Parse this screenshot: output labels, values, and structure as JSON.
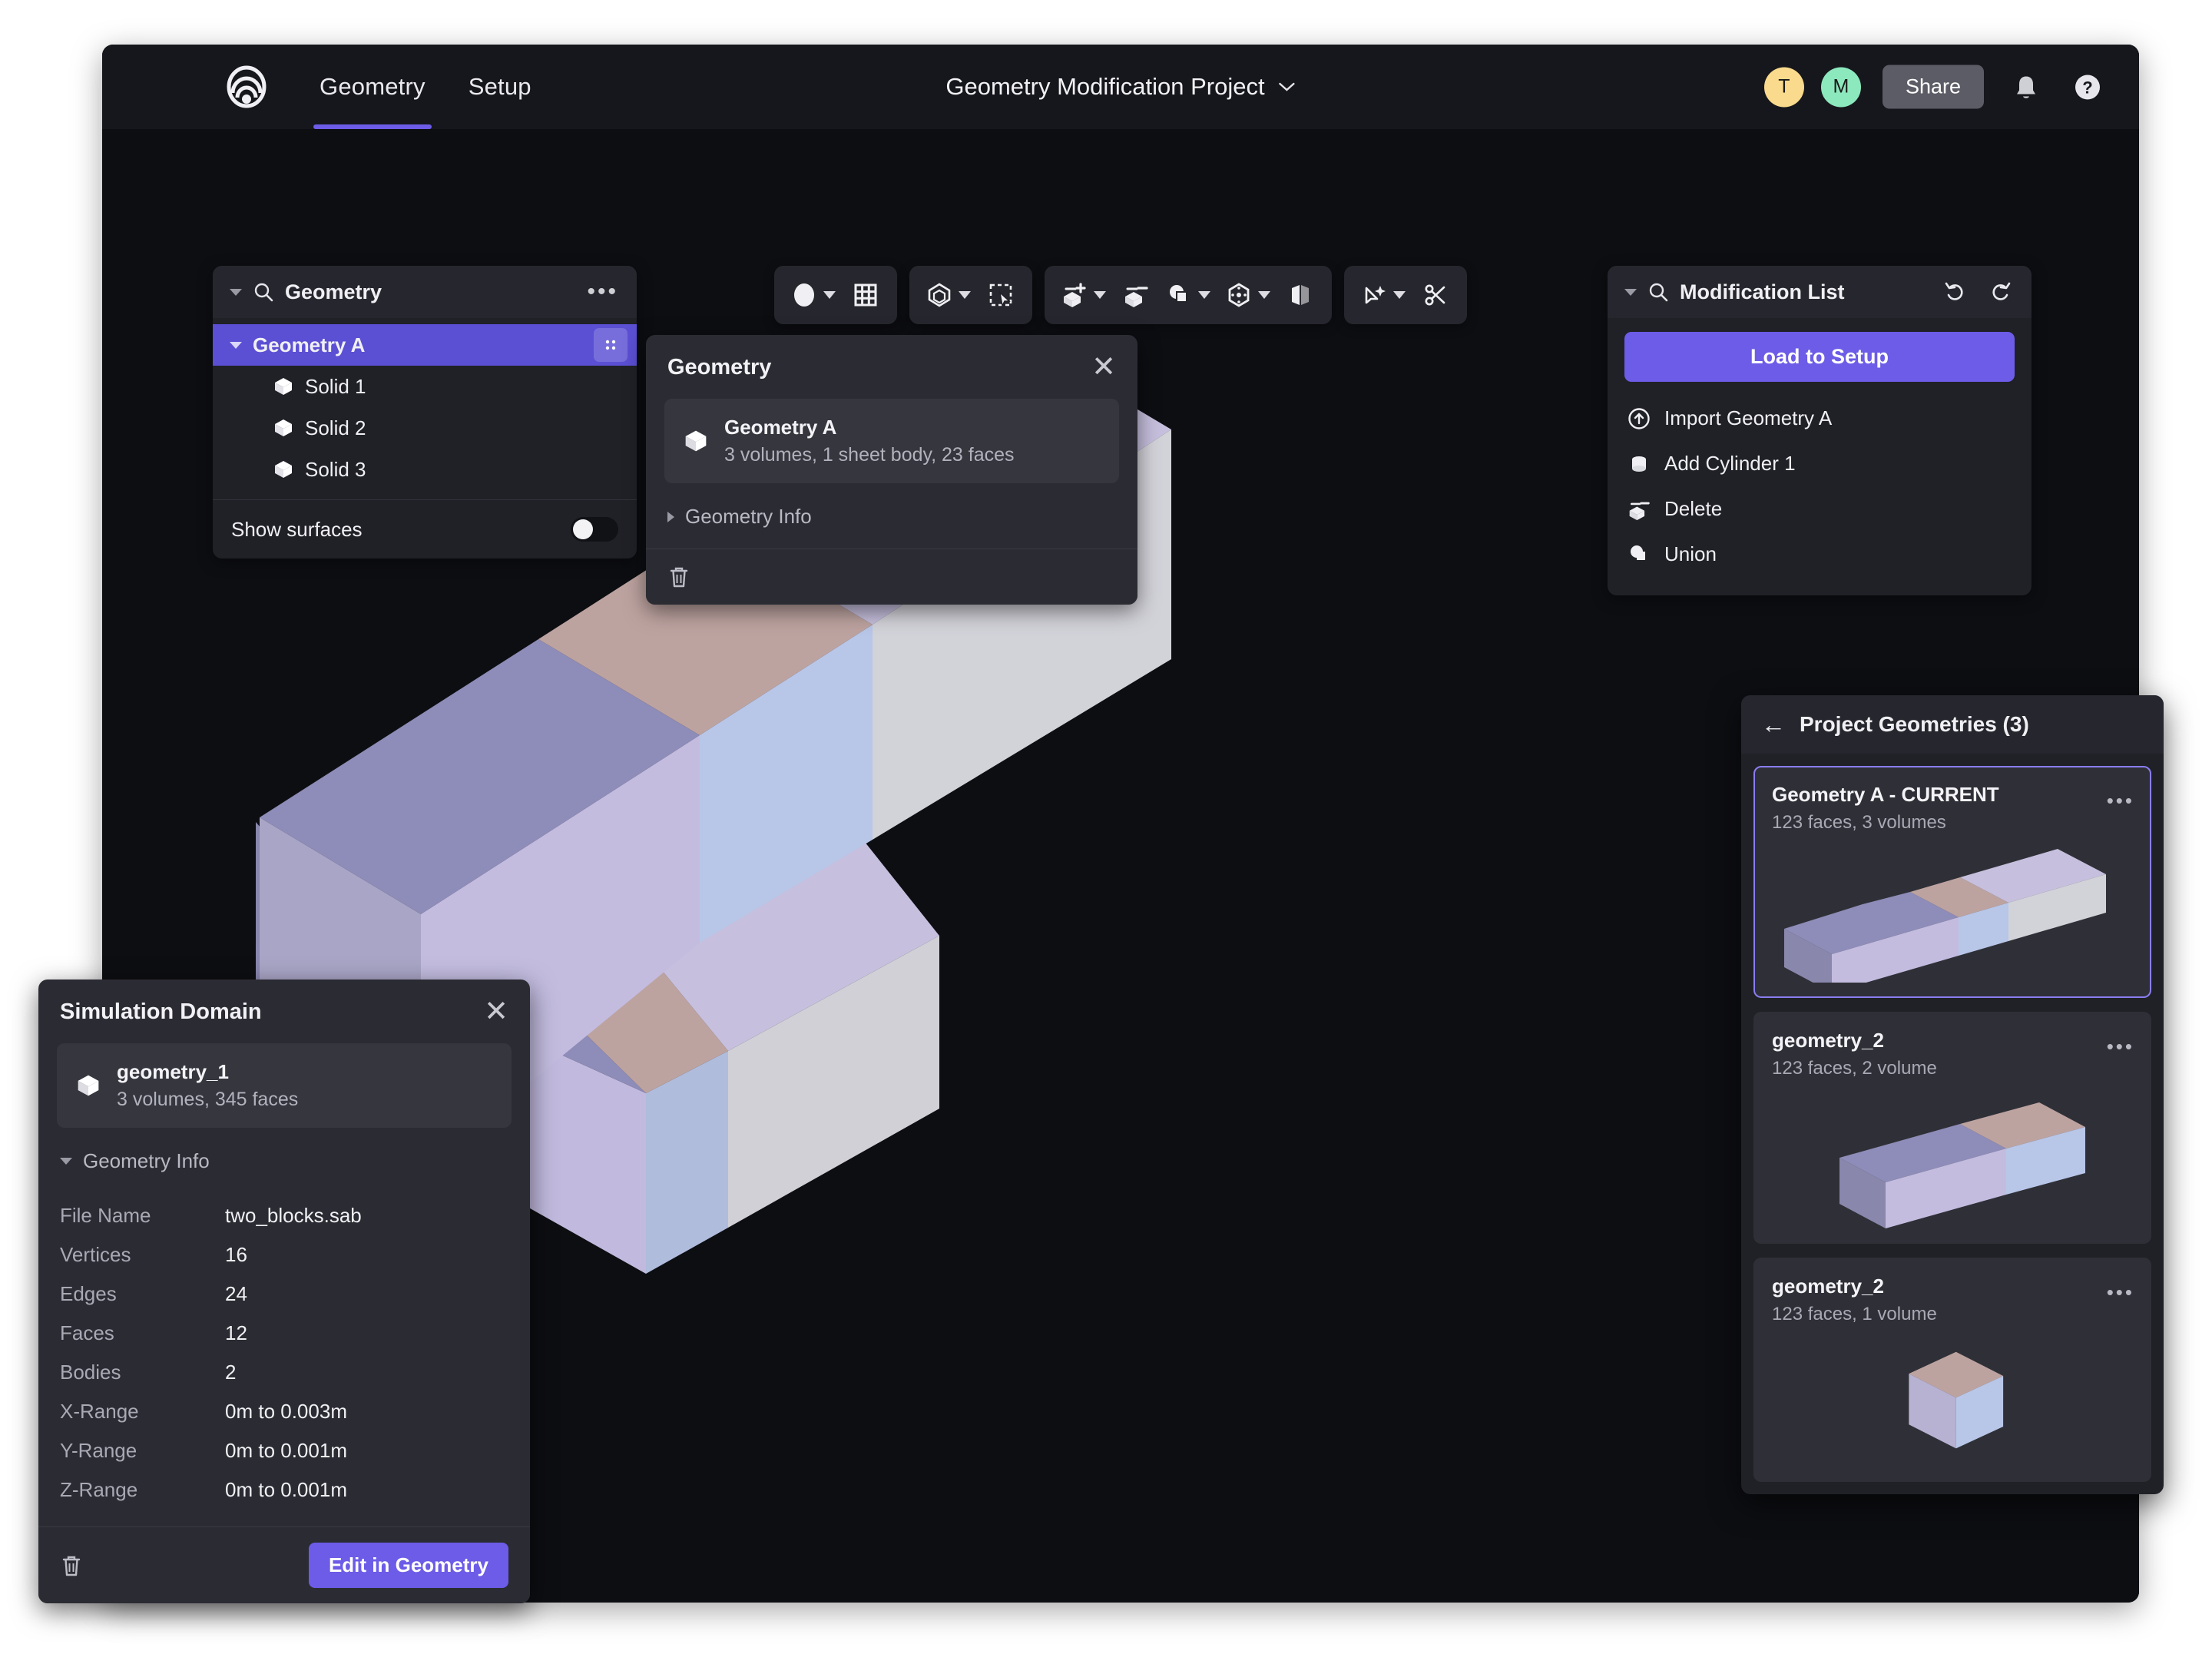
{
  "app": {
    "logo_icon": "concentric-waves-logo",
    "nav_tabs": [
      {
        "label": "Geometry",
        "active": true
      },
      {
        "label": "Setup",
        "active": false
      }
    ],
    "project_title": "Geometry Modification Project",
    "title_chevron_icon": "chevron-down-icon",
    "avatars": [
      {
        "initial": "T",
        "color": "#fada8c"
      },
      {
        "initial": "M",
        "color": "#8ce8bd"
      }
    ],
    "share_label": "Share",
    "notification_icon": "bell-icon",
    "help_icon": "question-mark-circle-icon"
  },
  "tree_panel": {
    "collapse_icon": "caret-down-icon",
    "search_icon": "search-icon",
    "title": "Geometry",
    "overflow_icon": "ellipsis-icon",
    "root": {
      "label": "Geometry A",
      "selected": true,
      "grip_icon": "drag-grip-icon"
    },
    "children": [
      {
        "label": "Solid 1",
        "icon": "cube-icon"
      },
      {
        "label": "Solid 2",
        "icon": "cube-icon"
      },
      {
        "label": "Solid 3",
        "icon": "cube-icon"
      }
    ],
    "show_surfaces": {
      "label": "Show surfaces",
      "enabled": false
    }
  },
  "toolbar": {
    "groups": [
      {
        "items": [
          {
            "icon": "filled-circle-icon",
            "has_chevron": true
          },
          {
            "icon": "grid-icon",
            "has_chevron": false
          }
        ]
      },
      {
        "items": [
          {
            "icon": "solid-body-icon",
            "has_chevron": true
          },
          {
            "icon": "box-select-cursor-icon",
            "has_chevron": false
          }
        ]
      },
      {
        "items": [
          {
            "icon": "add-body-icon",
            "has_chevron": true
          },
          {
            "icon": "subtract-body-icon",
            "has_chevron": false
          },
          {
            "icon": "boolean-intersect-icon",
            "has_chevron": true
          },
          {
            "icon": "transform-body-icon",
            "has_chevron": true
          },
          {
            "icon": "mirror-body-icon",
            "has_chevron": false
          }
        ]
      },
      {
        "items": [
          {
            "icon": "magic-select-icon",
            "has_chevron": true
          },
          {
            "icon": "scissors-icon",
            "has_chevron": false
          }
        ]
      }
    ]
  },
  "geometry_popup": {
    "title": "Geometry",
    "close_icon": "close-icon",
    "card": {
      "icon": "cube-icon",
      "name": "Geometry A",
      "details": "3 volumes, 1 sheet body, 23 faces"
    },
    "info_toggle": {
      "label": "Geometry Info",
      "expanded": false,
      "icon": "caret-right-icon"
    },
    "delete_icon": "trash-icon"
  },
  "modification_panel": {
    "collapse_icon": "caret-down-icon",
    "search_icon": "search-icon",
    "title": "Modification List",
    "undo_icon": "undo-icon",
    "redo_icon": "redo-icon",
    "load_button": "Load to Setup",
    "items": [
      {
        "label": "Import Geometry A",
        "icon": "import-arrow-circle-icon"
      },
      {
        "label": "Add Cylinder 1",
        "icon": "cylinder-icon"
      },
      {
        "label": "Delete",
        "icon": "subtract-body-icon"
      },
      {
        "label": "Union",
        "icon": "union-shapes-icon"
      }
    ]
  },
  "simulation_domain": {
    "title": "Simulation Domain",
    "close_icon": "close-icon",
    "card": {
      "icon": "cube-icon",
      "name": "geometry_1",
      "details": "3 volumes, 345 faces"
    },
    "info_toggle": {
      "label": "Geometry Info",
      "expanded": true,
      "icon": "caret-down-icon"
    },
    "info_rows": [
      {
        "key": "File Name",
        "value": "two_blocks.sab"
      },
      {
        "key": "Vertices",
        "value": "16"
      },
      {
        "key": "Edges",
        "value": "24"
      },
      {
        "key": "Faces",
        "value": "12"
      },
      {
        "key": "Bodies",
        "value": "2"
      },
      {
        "key": "X-Range",
        "value": "0m to 0.003m"
      },
      {
        "key": "Y-Range",
        "value": "0m to 0.001m"
      },
      {
        "key": "Z-Range",
        "value": "0m to 0.001m"
      }
    ],
    "delete_icon": "trash-icon",
    "edit_button": "Edit in Geometry"
  },
  "project_geometries": {
    "back_icon": "arrow-left-icon",
    "title": "Project Geometries (3)",
    "cards": [
      {
        "title": "Geometry A - CURRENT",
        "subtitle": "123 faces, 3 volumes",
        "current": true,
        "overflow_icon": "ellipsis-icon",
        "thumb": "long-bar-3-segments"
      },
      {
        "title": "geometry_2",
        "subtitle": "123 faces, 2 volume",
        "current": false,
        "overflow_icon": "ellipsis-icon",
        "thumb": "bar-2-segments"
      },
      {
        "title": "geometry_2",
        "subtitle": "123 faces, 1 volume",
        "current": false,
        "overflow_icon": "ellipsis-icon",
        "thumb": "single-cube"
      }
    ]
  },
  "colors": {
    "accent": "#6c5ce7",
    "accent_selected": "#5b4fd4",
    "panel": "#202127",
    "panel_alt": "#2b2c33",
    "viewport_bg": "#0d0e12",
    "topbar": "#16171c",
    "face_lavender": "#c2bbe0",
    "face_lavender_dark": "#8e8cb8",
    "face_blue": "#b8c6e8",
    "face_rose": "#bda3a0",
    "face_gray": "#cfcfd6",
    "face_top_light": "#c6bfdd"
  }
}
